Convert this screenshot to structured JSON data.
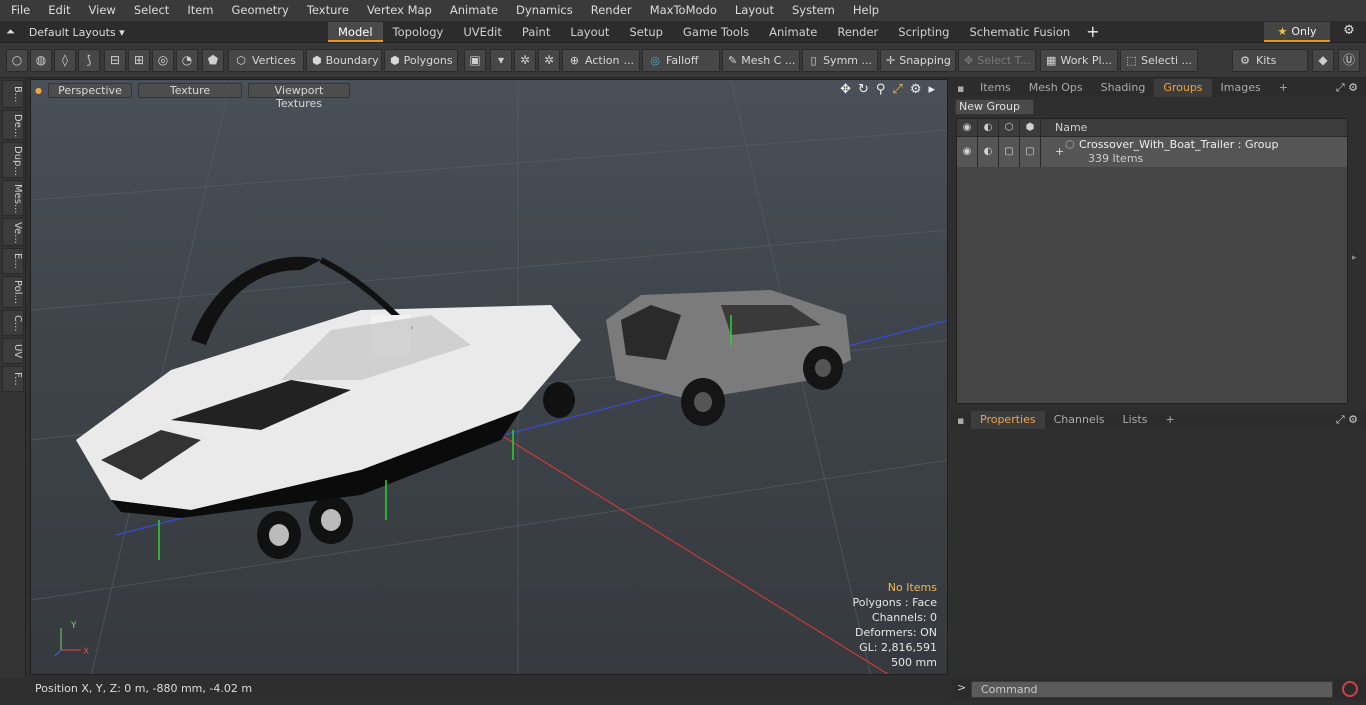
{
  "menu": [
    "File",
    "Edit",
    "View",
    "Select",
    "Item",
    "Geometry",
    "Texture",
    "Vertex Map",
    "Animate",
    "Dynamics",
    "Render",
    "MaxToModo",
    "Layout",
    "System",
    "Help"
  ],
  "layouts_label": "Default Layouts",
  "tabs": [
    "Model",
    "Topology",
    "UVEdit",
    "Paint",
    "Layout",
    "Setup",
    "Game Tools",
    "Animate",
    "Render",
    "Scripting",
    "Schematic Fusion"
  ],
  "active_tab": "Model",
  "only_label": "Only",
  "toolbar": {
    "vertices": "Vertices",
    "boundary": "Boundary",
    "polygons": "Polygons",
    "action": "Action",
    "falloff": "Falloff",
    "mesh": "Mesh C ...",
    "symm": "Symm ...",
    "snapping": "Snapping",
    "select_t": "Select T...",
    "work_pl": "Work Pl...",
    "selecti": "Selecti ...",
    "kits": "Kits"
  },
  "left_tabs": [
    "B...",
    "De...",
    "Dup...",
    "Mes...",
    "Ve...",
    "E...",
    "Pol...",
    "C...",
    "UV",
    "F..."
  ],
  "viewport": {
    "perspective": "Perspective",
    "texture": "Texture",
    "viewport_textures": "Viewport Textures",
    "info": {
      "no_items": "No Items",
      "polygons": "Polygons : Face",
      "channels": "Channels: 0",
      "deformers": "Deformers: ON",
      "gl": "GL: 2,816,591",
      "scale": "500 mm"
    }
  },
  "status": "Position X, Y, Z:   0 m, -880 mm, -4.02 m",
  "right_tabs": [
    "Items",
    "Mesh Ops",
    "Shading",
    "Groups",
    "Images"
  ],
  "active_right_tab": "Groups",
  "new_group": "New Group",
  "group_header_name": "Name",
  "group": {
    "name": "Crossover_With_Boat_Trailer : Group",
    "count": "339 Items"
  },
  "props_tabs": [
    "Properties",
    "Channels",
    "Lists"
  ],
  "command_placeholder": "Command",
  "colors": {
    "accent": "#e09a30",
    "groups_tab": "#f0a440"
  }
}
